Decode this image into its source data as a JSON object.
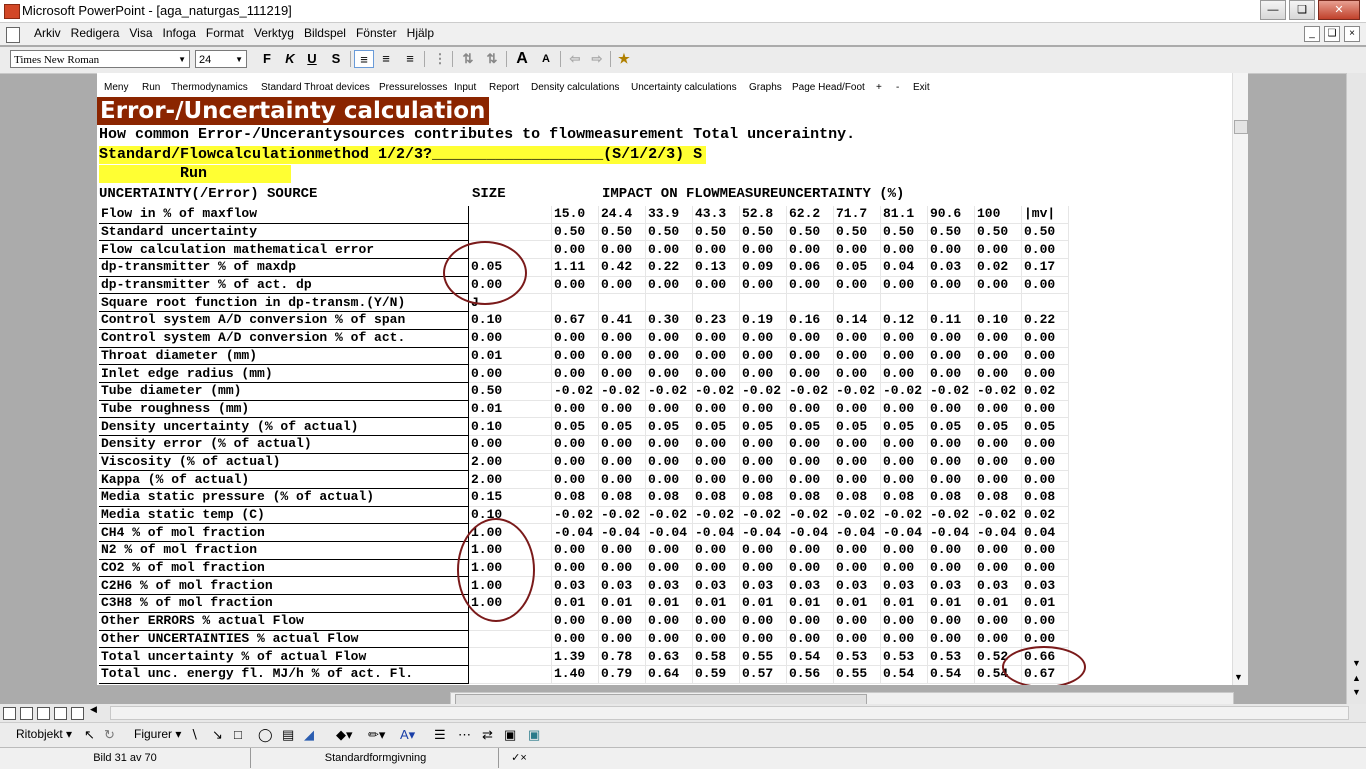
{
  "window": {
    "title": "Microsoft PowerPoint - [aga_naturgas_111219]"
  },
  "menubar": [
    "Arkiv",
    "Redigera",
    "Visa",
    "Infoga",
    "Format",
    "Verktyg",
    "Bildspel",
    "Fönster",
    "Hjälp"
  ],
  "toolbar": {
    "font": "Times New Roman",
    "size": "24"
  },
  "app_menu": [
    "Meny",
    "Run",
    "Thermodynamics",
    "Standard Throat devices",
    "Pressurelosses",
    "Input",
    "Report",
    "Density calculations",
    "Uncertainty calculations",
    "Graphs",
    "Page Head/Foot",
    "+",
    "-",
    "Exit"
  ],
  "slide": {
    "heading": "Error-/Uncertainty calculation",
    "subtitle": "How common Error-/Uncerantysources contributes to flowmeasurement Total unceraintny.",
    "std_line": "Standard/Flowcalculationmethod 1/2/3?___________________(S/1/2/3) S",
    "run": "Run",
    "col_source": "UNCERTAINTY(/Error) SOURCE",
    "col_size": "SIZE",
    "col_impact": "IMPACT ON FLOWMEASUREUNCERTAINTY (%)",
    "rows": [
      {
        "label": "Flow in % of maxflow",
        "size": "",
        "values": [
          "15.0",
          "24.4",
          "33.9",
          "43.3",
          "52.8",
          "62.2",
          "71.7",
          "81.1",
          "90.6",
          "100",
          "|mv|"
        ]
      },
      {
        "label": "Standard uncertainty",
        "size": "",
        "values": [
          "0.50",
          "0.50",
          "0.50",
          "0.50",
          "0.50",
          "0.50",
          "0.50",
          "0.50",
          "0.50",
          "0.50",
          "0.50"
        ]
      },
      {
        "label": "Flow calculation mathematical error",
        "size": "",
        "values": [
          "0.00",
          "0.00",
          "0.00",
          "0.00",
          "0.00",
          "0.00",
          "0.00",
          "0.00",
          "0.00",
          "0.00",
          "0.00"
        ]
      },
      {
        "label": "dp-transmitter % of maxdp",
        "size": "0.05",
        "values": [
          "1.11",
          "0.42",
          "0.22",
          "0.13",
          "0.09",
          "0.06",
          "0.05",
          "0.04",
          "0.03",
          "0.02",
          "0.17"
        ]
      },
      {
        "label": "dp-transmitter % of act. dp",
        "size": "0.00",
        "values": [
          "0.00",
          "0.00",
          "0.00",
          "0.00",
          "0.00",
          "0.00",
          "0.00",
          "0.00",
          "0.00",
          "0.00",
          "0.00"
        ]
      },
      {
        "label": "Square root function in dp-transm.(Y/N)",
        "size": "J",
        "values": [
          "",
          "",
          "",
          "",
          "",
          "",
          "",
          "",
          "",
          "",
          ""
        ]
      },
      {
        "label": "Control system A/D conversion % of span",
        "size": "0.10",
        "values": [
          "0.67",
          "0.41",
          "0.30",
          "0.23",
          "0.19",
          "0.16",
          "0.14",
          "0.12",
          "0.11",
          "0.10",
          "0.22"
        ]
      },
      {
        "label": "Control system A/D conversion % of act.",
        "size": "0.00",
        "values": [
          "0.00",
          "0.00",
          "0.00",
          "0.00",
          "0.00",
          "0.00",
          "0.00",
          "0.00",
          "0.00",
          "0.00",
          "0.00"
        ]
      },
      {
        "label": "Throat diameter (mm)",
        "size": "0.01",
        "values": [
          "0.00",
          "0.00",
          "0.00",
          "0.00",
          "0.00",
          "0.00",
          "0.00",
          "0.00",
          "0.00",
          "0.00",
          "0.00"
        ]
      },
      {
        "label": "Inlet edge radius (mm)",
        "size": "0.00",
        "values": [
          "0.00",
          "0.00",
          "0.00",
          "0.00",
          "0.00",
          "0.00",
          "0.00",
          "0.00",
          "0.00",
          "0.00",
          "0.00"
        ]
      },
      {
        "label": "Tube diameter (mm)",
        "size": "0.50",
        "values": [
          "-0.02",
          "-0.02",
          "-0.02",
          "-0.02",
          "-0.02",
          "-0.02",
          "-0.02",
          "-0.02",
          "-0.02",
          "-0.02",
          "0.02"
        ]
      },
      {
        "label": "Tube roughness (mm)",
        "size": "0.01",
        "values": [
          "0.00",
          "0.00",
          "0.00",
          "0.00",
          "0.00",
          "0.00",
          "0.00",
          "0.00",
          "0.00",
          "0.00",
          "0.00"
        ]
      },
      {
        "label": "Density uncertainty (% of actual)",
        "size": "0.10",
        "values": [
          "0.05",
          "0.05",
          "0.05",
          "0.05",
          "0.05",
          "0.05",
          "0.05",
          "0.05",
          "0.05",
          "0.05",
          "0.05"
        ]
      },
      {
        "label": "Density error (% of actual)",
        "size": "0.00",
        "values": [
          "0.00",
          "0.00",
          "0.00",
          "0.00",
          "0.00",
          "0.00",
          "0.00",
          "0.00",
          "0.00",
          "0.00",
          "0.00"
        ]
      },
      {
        "label": "Viscosity (% of actual)",
        "size": "2.00",
        "values": [
          "0.00",
          "0.00",
          "0.00",
          "0.00",
          "0.00",
          "0.00",
          "0.00",
          "0.00",
          "0.00",
          "0.00",
          "0.00"
        ]
      },
      {
        "label": "Kappa (% of actual)",
        "size": "2.00",
        "values": [
          "0.00",
          "0.00",
          "0.00",
          "0.00",
          "0.00",
          "0.00",
          "0.00",
          "0.00",
          "0.00",
          "0.00",
          "0.00"
        ]
      },
      {
        "label": "Media static pressure (% of actual)",
        "size": "0.15",
        "values": [
          "0.08",
          "0.08",
          "0.08",
          "0.08",
          "0.08",
          "0.08",
          "0.08",
          "0.08",
          "0.08",
          "0.08",
          "0.08"
        ]
      },
      {
        "label": "Media static temp (C)",
        "size": "0.10",
        "values": [
          "-0.02",
          "-0.02",
          "-0.02",
          "-0.02",
          "-0.02",
          "-0.02",
          "-0.02",
          "-0.02",
          "-0.02",
          "-0.02",
          "0.02"
        ]
      },
      {
        "label": "CH4  % of mol fraction",
        "size": "1.00",
        "values": [
          "-0.04",
          "-0.04",
          "-0.04",
          "-0.04",
          "-0.04",
          "-0.04",
          "-0.04",
          "-0.04",
          "-0.04",
          "-0.04",
          "0.04"
        ]
      },
      {
        "label": "N2   % of mol fraction",
        "size": "1.00",
        "values": [
          "0.00",
          "0.00",
          "0.00",
          "0.00",
          "0.00",
          "0.00",
          "0.00",
          "0.00",
          "0.00",
          "0.00",
          "0.00"
        ]
      },
      {
        "label": "CO2  % of mol fraction",
        "size": "1.00",
        "values": [
          "0.00",
          "0.00",
          "0.00",
          "0.00",
          "0.00",
          "0.00",
          "0.00",
          "0.00",
          "0.00",
          "0.00",
          "0.00"
        ]
      },
      {
        "label": "C2H6 % of mol fraction",
        "size": "1.00",
        "values": [
          "0.03",
          "0.03",
          "0.03",
          "0.03",
          "0.03",
          "0.03",
          "0.03",
          "0.03",
          "0.03",
          "0.03",
          "0.03"
        ]
      },
      {
        "label": "C3H8 % of mol fraction",
        "size": "1.00",
        "values": [
          "0.01",
          "0.01",
          "0.01",
          "0.01",
          "0.01",
          "0.01",
          "0.01",
          "0.01",
          "0.01",
          "0.01",
          "0.01"
        ]
      },
      {
        "label": "Other ERRORS % actual Flow",
        "size": "",
        "values": [
          "0.00",
          "0.00",
          "0.00",
          "0.00",
          "0.00",
          "0.00",
          "0.00",
          "0.00",
          "0.00",
          "0.00",
          "0.00"
        ]
      },
      {
        "label": "Other UNCERTAINTIES % actual Flow",
        "size": "",
        "values": [
          "0.00",
          "0.00",
          "0.00",
          "0.00",
          "0.00",
          "0.00",
          "0.00",
          "0.00",
          "0.00",
          "0.00",
          "0.00"
        ]
      },
      {
        "label": "Total uncertainty % of actual Flow",
        "size": "",
        "values": [
          "1.39",
          "0.78",
          "0.63",
          "0.58",
          "0.55",
          "0.54",
          "0.53",
          "0.53",
          "0.53",
          "0.52",
          "0.66"
        ]
      },
      {
        "label": "Total unc. energy fl. MJ/h % of act. Fl.",
        "size": "",
        "values": [
          "1.40",
          "0.79",
          "0.64",
          "0.59",
          "0.57",
          "0.56",
          "0.55",
          "0.54",
          "0.54",
          "0.54",
          "0.67"
        ]
      }
    ]
  },
  "drawbar": {
    "ritobjekt": "Ritobjekt",
    "figurer": "Figurer"
  },
  "status": {
    "slide": "Bild 31 av 70",
    "design": "Standardformgivning"
  }
}
